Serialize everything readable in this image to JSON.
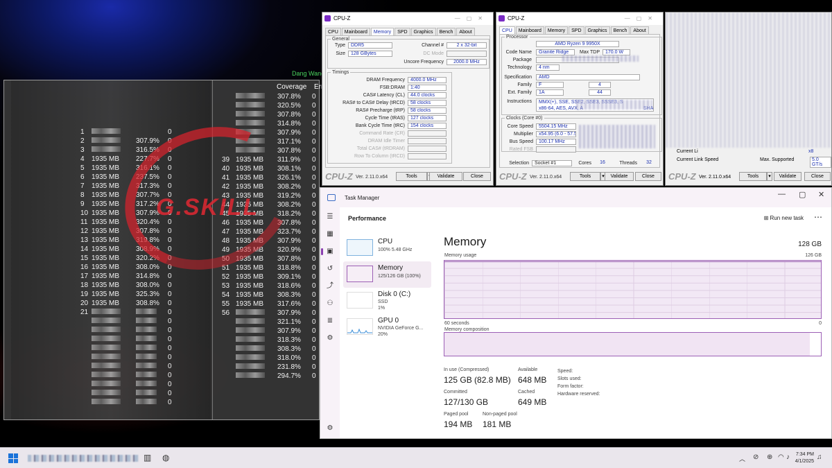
{
  "memtest": {
    "title": "Dang Wang",
    "header_coverage": "Coverage",
    "header_errors": "Err",
    "left_rows": [
      {
        "id": "1",
        "size": "",
        "cov": "",
        "err": "0"
      },
      {
        "id": "2",
        "size": "",
        "cov": "307.9%",
        "err": "0"
      },
      {
        "id": "3",
        "size": "",
        "cov": "316.5%",
        "err": "0"
      },
      {
        "id": "4",
        "size": "1935 MB",
        "cov": "227.7%",
        "err": "0"
      },
      {
        "id": "5",
        "size": "1935 MB",
        "cov": "316.1%",
        "err": "0"
      },
      {
        "id": "6",
        "size": "1935 MB",
        "cov": "237.5%",
        "err": "0"
      },
      {
        "id": "7",
        "size": "1935 MB",
        "cov": "317.3%",
        "err": "0"
      },
      {
        "id": "8",
        "size": "1935 MB",
        "cov": "307.7%",
        "err": "0"
      },
      {
        "id": "9",
        "size": "1935 MB",
        "cov": "317.2%",
        "err": "0"
      },
      {
        "id": "10",
        "size": "1935 MB",
        "cov": "307.9%",
        "err": "0"
      },
      {
        "id": "11",
        "size": "1935 MB",
        "cov": "320.4%",
        "err": "0"
      },
      {
        "id": "12",
        "size": "1935 MB",
        "cov": "307.8%",
        "err": "0"
      },
      {
        "id": "13",
        "size": "1935 MB",
        "cov": "319.8%",
        "err": "0"
      },
      {
        "id": "14",
        "size": "1935 MB",
        "cov": "308.9%",
        "err": "0"
      },
      {
        "id": "15",
        "size": "1935 MB",
        "cov": "320.2%",
        "err": "0"
      },
      {
        "id": "16",
        "size": "1935 MB",
        "cov": "308.0%",
        "err": "0"
      },
      {
        "id": "17",
        "size": "1935 MB",
        "cov": "314.8%",
        "err": "0"
      },
      {
        "id": "18",
        "size": "1935 MB",
        "cov": "308.0%",
        "err": "0"
      },
      {
        "id": "19",
        "size": "1935 MB",
        "cov": "325.3%",
        "err": "0"
      },
      {
        "id": "20",
        "size": "1935 MB",
        "cov": "308.8%",
        "err": "0"
      },
      {
        "id": "21",
        "size": "",
        "cov": "",
        "err": "0"
      },
      {
        "id": "",
        "size": "",
        "cov": "",
        "err": "0"
      },
      {
        "id": "",
        "size": "",
        "cov": "",
        "err": "0"
      },
      {
        "id": "",
        "size": "",
        "cov": "",
        "err": "0"
      },
      {
        "id": "",
        "size": "",
        "cov": "",
        "err": "0"
      },
      {
        "id": "",
        "size": "",
        "cov": "",
        "err": "0"
      },
      {
        "id": "",
        "size": "",
        "cov": "",
        "err": "0"
      },
      {
        "id": "",
        "size": "",
        "cov": "",
        "err": "0"
      },
      {
        "id": "",
        "size": "",
        "cov": "",
        "err": "0"
      },
      {
        "id": "",
        "size": "",
        "cov": "",
        "err": "0"
      },
      {
        "id": "",
        "size": "",
        "cov": "",
        "err": "0"
      }
    ],
    "right_rows": [
      {
        "id": "",
        "size": "",
        "cov": "307.8%",
        "err": "0"
      },
      {
        "id": "",
        "size": "",
        "cov": "320.5%",
        "err": "0"
      },
      {
        "id": "",
        "size": "",
        "cov": "307.8%",
        "err": "0"
      },
      {
        "id": "",
        "size": "",
        "cov": "314.8%",
        "err": "0"
      },
      {
        "id": "",
        "size": "",
        "cov": "307.9%",
        "err": "0"
      },
      {
        "id": "",
        "size": "",
        "cov": "317.1%",
        "err": "0"
      },
      {
        "id": "",
        "size": "",
        "cov": "307.8%",
        "err": "0"
      },
      {
        "id": "39",
        "size": "1935 MB",
        "cov": "311.9%",
        "err": "0"
      },
      {
        "id": "40",
        "size": "1935 MB",
        "cov": "308.1%",
        "err": "0"
      },
      {
        "id": "41",
        "size": "1935 MB",
        "cov": "326.1%",
        "err": "0"
      },
      {
        "id": "42",
        "size": "1935 MB",
        "cov": "308.2%",
        "err": "0"
      },
      {
        "id": "43",
        "size": "1935 MB",
        "cov": "319.2%",
        "err": "0"
      },
      {
        "id": "44",
        "size": "1935 MB",
        "cov": "308.2%",
        "err": "0"
      },
      {
        "id": "45",
        "size": "1935 MB",
        "cov": "318.2%",
        "err": "0"
      },
      {
        "id": "46",
        "size": "1935 MB",
        "cov": "307.8%",
        "err": "0"
      },
      {
        "id": "47",
        "size": "1935 MB",
        "cov": "323.7%",
        "err": "0"
      },
      {
        "id": "48",
        "size": "1935 MB",
        "cov": "307.9%",
        "err": "0"
      },
      {
        "id": "49",
        "size": "1935 MB",
        "cov": "320.9%",
        "err": "0"
      },
      {
        "id": "50",
        "size": "1935 MB",
        "cov": "307.8%",
        "err": "0"
      },
      {
        "id": "51",
        "size": "1935 MB",
        "cov": "318.8%",
        "err": "0"
      },
      {
        "id": "52",
        "size": "1935 MB",
        "cov": "309.1%",
        "err": "0"
      },
      {
        "id": "53",
        "size": "1935 MB",
        "cov": "318.6%",
        "err": "0"
      },
      {
        "id": "54",
        "size": "1935 MB",
        "cov": "308.3%",
        "err": "0"
      },
      {
        "id": "55",
        "size": "1935 MB",
        "cov": "317.6%",
        "err": "0"
      },
      {
        "id": "56",
        "size": "",
        "cov": "307.9%",
        "err": "0"
      },
      {
        "id": "",
        "size": "",
        "cov": "321.1%",
        "err": "0"
      },
      {
        "id": "",
        "size": "",
        "cov": "307.9%",
        "err": "0"
      },
      {
        "id": "",
        "size": "",
        "cov": "318.3%",
        "err": "0"
      },
      {
        "id": "",
        "size": "",
        "cov": "308.3%",
        "err": "0"
      },
      {
        "id": "",
        "size": "",
        "cov": "318.0%",
        "err": "0"
      },
      {
        "id": "",
        "size": "",
        "cov": "231.8%",
        "err": "0"
      },
      {
        "id": "",
        "size": "",
        "cov": "294.7%",
        "err": "0"
      }
    ]
  },
  "watermark": "G.SKILL",
  "cpuz_common": {
    "title": "CPU-Z",
    "tabs": [
      "CPU",
      "Mainboard",
      "Memory",
      "SPD",
      "Graphics",
      "Bench",
      "About"
    ],
    "logo": "CPU-Z",
    "version": "Ver. 2.11.0.x64",
    "tools": "Tools",
    "validate": "Validate",
    "close": "Close"
  },
  "cpuz_memory": {
    "general_legend": "General",
    "type_label": "Type",
    "type_value": "DDR5",
    "size_label": "Size",
    "size_value": "128 GBytes",
    "channel_label": "Channel #",
    "channel_value": "2 x 32-bit",
    "dcmode_label": "DC Mode",
    "uncore_label": "Uncore Frequency",
    "uncore_value": "2000.0 MHz",
    "timings_legend": "Timings",
    "timings": [
      {
        "label": "DRAM Frequency",
        "value": "4000.0 MHz",
        "gray": false
      },
      {
        "label": "FSB:DRAM",
        "value": "1:40",
        "gray": false
      },
      {
        "label": "CAS# Latency (CL)",
        "value": "44.0 clocks",
        "gray": false
      },
      {
        "label": "RAS# to CAS# Delay (tRCD)",
        "value": "58 clocks",
        "gray": false
      },
      {
        "label": "RAS# Precharge (tRP)",
        "value": "58 clocks",
        "gray": false
      },
      {
        "label": "Cycle Time (tRAS)",
        "value": "127 clocks",
        "gray": false
      },
      {
        "label": "Bank Cycle Time (tRC)",
        "value": "154 clocks",
        "gray": false
      },
      {
        "label": "Command Rate (CR)",
        "value": "",
        "gray": true
      },
      {
        "label": "DRAM Idle Timer",
        "value": "",
        "gray": true
      },
      {
        "label": "Total CAS# (tRDRAM)",
        "value": "",
        "gray": true
      },
      {
        "label": "Row To Column (tRCD)",
        "value": "",
        "gray": true
      }
    ]
  },
  "cpuz_cpu": {
    "processor_legend": "Processor",
    "name_value": "AMD Ryzen 9 9950X",
    "codename_label": "Code Name",
    "codename_value": "Granite Ridge",
    "maxtdp_label": "Max TDP",
    "maxtdp_value": "170.0 W",
    "package_label": "Package",
    "technology_label": "Technology",
    "technology_value": "4 nm",
    "specification_label": "Specification",
    "specification_value": "AMD",
    "family_label": "Family",
    "family_value": "F",
    "family_value2": "4",
    "extfamily_label": "Ext. Family",
    "extfamily_value": "1A",
    "extfamily_value2": "44",
    "instructions_label": "Instructions",
    "instructions_line1": "MMX(+), SSE, SSE2, SSE3, SSSE3, S",
    "instructions_line2": "x86-64, AES, AVX, A",
    "instructions_tail": "SHA",
    "clocks_legend": "Clocks (Core #0)",
    "corespeed_label": "Core Speed",
    "corespeed_value": "5504.15 MHz",
    "multiplier_label": "Multiplier",
    "multiplier_value": "x54.95 (6.0 - 57.5",
    "busspeed_label": "Bus Speed",
    "busspeed_value": "100.17 MHz",
    "ratedfsb_label": "Rated FSB",
    "selection_label": "Selection",
    "selection_value": "Socket #1",
    "cores_label": "Cores",
    "cores_value": "16",
    "threads_label": "Threads",
    "threads_value": "32"
  },
  "cpuz_third": {
    "current_link_width_label": "Current Li",
    "current_link_width_value": "x8",
    "current_link_speed_label": "Current Link Speed",
    "max_supported_label": "Max. Supported",
    "max_supported_value": "5.0 GT/s"
  },
  "taskmanager": {
    "title": "Task Manager",
    "page_title": "Performance",
    "run_new_task": "Run new task",
    "items": [
      {
        "name": "CPU",
        "sub1": "100% 5.48 GHz",
        "sub2": ""
      },
      {
        "name": "Memory",
        "sub1": "125/126 GB (100%)",
        "sub2": ""
      },
      {
        "name": "Disk 0 (C:)",
        "sub1": "SSD",
        "sub2": "1%"
      },
      {
        "name": "GPU 0",
        "sub1": "NVIDIA GeForce G...",
        "sub2": "20%"
      }
    ],
    "detail_title": "Memory",
    "detail_total": "128 GB",
    "memory_usage_label": "Memory usage",
    "memory_usage_max": "126 GB",
    "memory_usage_fraction": 0.99,
    "x_left": "60 seconds",
    "x_right": "0",
    "composition_label": "Memory composition",
    "composition_used_fraction": 0.97,
    "stats": [
      {
        "key": "In use (Compressed)",
        "value": "125 GB (82.8 MB)"
      },
      {
        "key": "Available",
        "value": "648 MB"
      },
      {
        "key": "Committed",
        "value": "127/130 GB"
      },
      {
        "key": "Cached",
        "value": "649 MB"
      },
      {
        "key": "Paged pool",
        "value": "194 MB"
      },
      {
        "key": "Non-paged pool",
        "value": "181 MB"
      }
    ],
    "specs": [
      "Speed:",
      "Slots used:",
      "Form factor:",
      "Hardware reserved:"
    ]
  },
  "taskbar": {
    "time": "7:34 PM",
    "date": "4/1/2025"
  }
}
